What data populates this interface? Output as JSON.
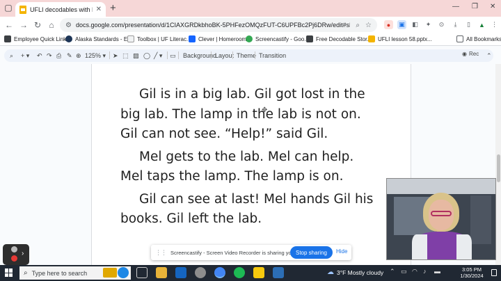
{
  "browser": {
    "tab_title": "UFLI decodables with Read Alo...",
    "url": "docs.google.com/presentation/d/1CIAXGRDkbhoBK-5PHFezOMQzFUT-C6UPFBc2Pj6DRw/edit#slide=id.g29ff6...",
    "bookmarks": [
      "Employee Quick Links",
      "Alaska Standards - E...",
      "Toolbox | UF Literac...",
      "Clever | Homeroom",
      "Screencastify - Goo...",
      "Free Decodable Stor...",
      "UFLI lesson 58.pptx...",
      "All Bookmarks"
    ]
  },
  "slides_toolbar": {
    "zoom": "125%",
    "background_label": "Background",
    "layout_label": "Layout",
    "theme_label": "Theme",
    "transition_label": "Transition",
    "rec_label": "Rec"
  },
  "slide": {
    "paragraphs": [
      {
        "lines": [
          "Gil is in a big lab. Gil got lost in the",
          "big lab. The lamp in the lab is not on.",
          "Gil can not see. “Help!” said Gil."
        ]
      },
      {
        "lines": [
          "Mel gets to the lab. Mel can help.",
          "Mel taps the lamp. The lamp is on."
        ]
      },
      {
        "lines": [
          "Gil can see at last! Mel hands Gil his",
          "books. Gil left the lab."
        ]
      }
    ]
  },
  "screencastify": {
    "share_message": "Screencastify - Screen Video Recorder is sharing your screen.",
    "stop_label": "Stop sharing",
    "hide_label": "Hide"
  },
  "taskbar": {
    "search_placeholder": "Type here to search",
    "weather": "3°F  Mostly cloudy",
    "time": "3:05 PM",
    "date": "1/30/2024"
  },
  "colors": {
    "tabstrip": "#f6d7d7",
    "accent": "#1a73e8",
    "taskbar": "#202833"
  }
}
